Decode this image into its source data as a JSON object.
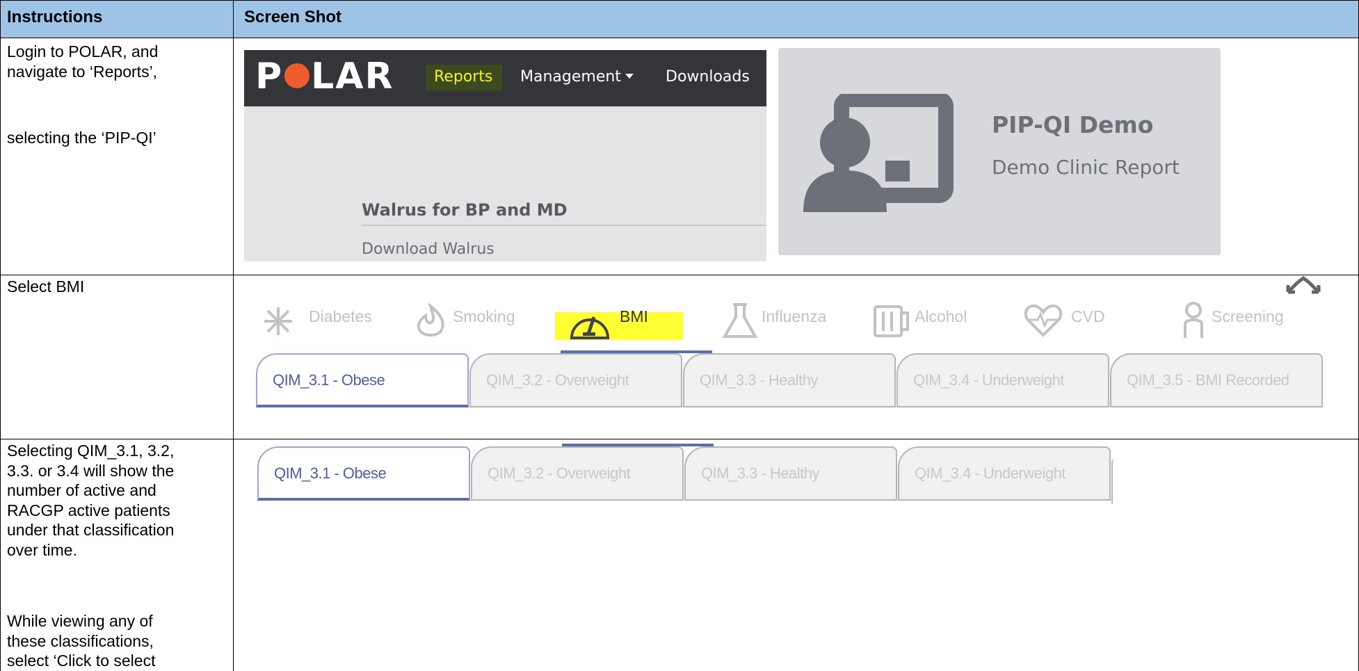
{
  "table": {
    "header_instructions": "Instructions",
    "header_screenshot": "Screen Shot"
  },
  "rows": [
    {
      "instructions_lines": [
        "Login to POLAR, and",
        "navigate to ‘Reports’,"
      ],
      "instructions_lines_b": [
        "selecting the ‘PIP-QI’"
      ]
    },
    {
      "instructions_lines": [
        "Select BMI"
      ]
    },
    {
      "instructions_lines": [
        "Selecting QIM_3.1, 3.2,",
        "3.3. or 3.4 will show the",
        "number of active and",
        "RACGP active patients",
        "under that classification",
        "over time."
      ],
      "instructions_lines_b": [
        "While viewing any of",
        "these classifications,",
        "select ‘Click to select"
      ]
    }
  ],
  "polar": {
    "logo_left": "P",
    "logo_right": "LAR",
    "nav": [
      "Reports",
      "Management",
      "Downloads"
    ],
    "walrus_title": "Walrus for BP and MD",
    "walrus_download": "Download Walrus",
    "card_title": "PIP-QI Demo",
    "card_subtitle": "Demo Clinic Report"
  },
  "categories": [
    "Diabetes",
    "Smoking",
    "BMI",
    "Influenza",
    "Alcohol",
    "CVD",
    "Screening"
  ],
  "tabs_row2": [
    "QIM_3.1 - Obese",
    "QIM_3.2 - Overweight",
    "QIM_3.3 - Healthy",
    "QIM_3.4 - Underweight",
    "QIM_3.5 - BMI Recorded"
  ],
  "tabs_row3": [
    "QIM_3.1 - Obese",
    "QIM_3.2 - Overweight",
    "QIM_3.3 - Healthy",
    "QIM_3.4 - Underweight"
  ],
  "colors": {
    "header_bg": "#9dc3e6",
    "highlight_yellow": "#ffff33",
    "tab_active": "#5b6fa8",
    "nav_bg": "#333539"
  }
}
